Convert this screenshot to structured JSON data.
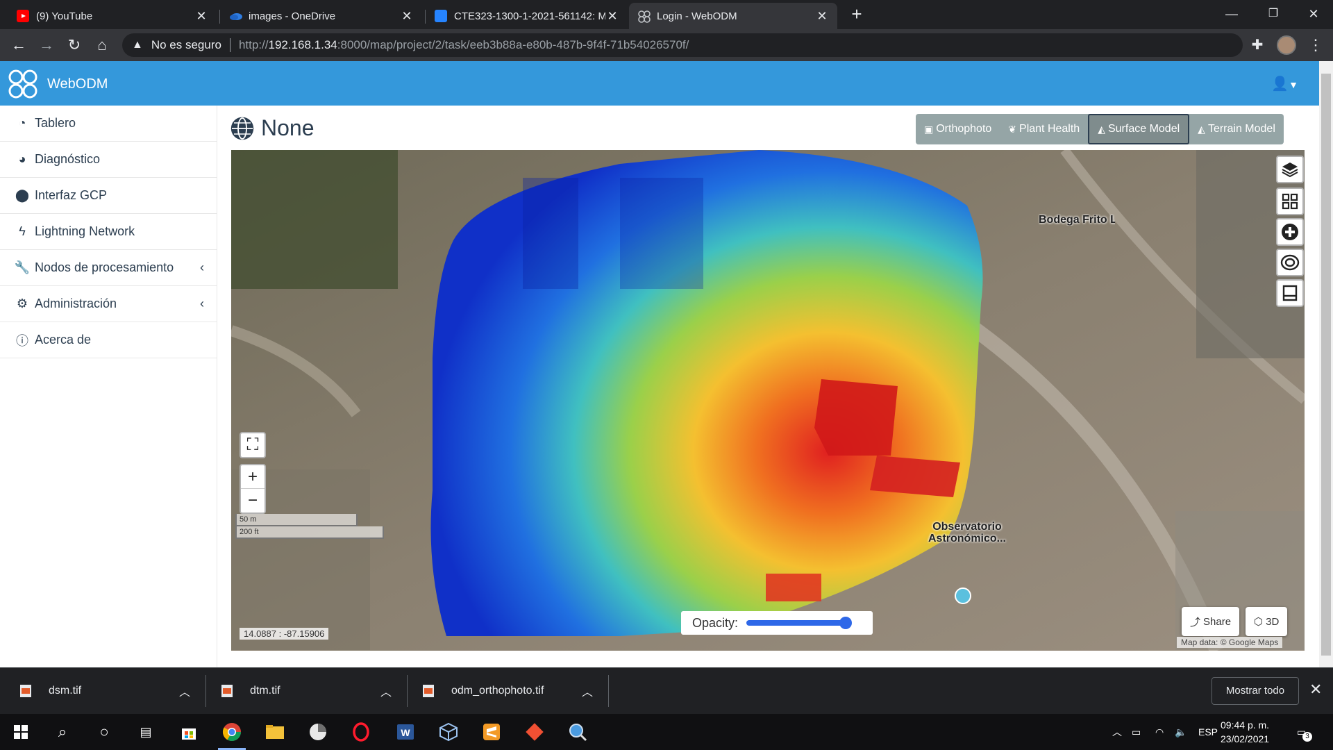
{
  "browser": {
    "tabs": [
      {
        "title": "(9) YouTube",
        "favicon": "youtube-icon",
        "color": "#ff0000"
      },
      {
        "title": "images - OneDrive",
        "favicon": "onedrive-icon",
        "color": "#2f7de1"
      },
      {
        "title": "CTE323-1300-1-2021-561142: M",
        "favicon": "jira-icon",
        "color": "#2684ff"
      },
      {
        "title": "Login - WebODM",
        "favicon": "webodm-icon",
        "color": "#9aa0a6"
      }
    ],
    "address": {
      "security_label": "No es seguro",
      "url_proto": "http://",
      "url_host": "192.168.1.34",
      "url_path": ":8000/map/project/2/task/eeb3b88a-e80b-487b-9f4f-71b54026570f/"
    }
  },
  "app": {
    "brand": "WebODM",
    "accent_color": "#3498db",
    "sidebar": {
      "items": [
        {
          "label": "Tablero",
          "icon": "dashboard-icon"
        },
        {
          "label": "Diagnóstico",
          "icon": "pie-chart-icon"
        },
        {
          "label": "Interfaz GCP",
          "icon": "map-marker-icon"
        },
        {
          "label": "Lightning Network",
          "icon": "bolt-icon"
        },
        {
          "label": "Nodos de procesamiento",
          "icon": "wrench-icon"
        },
        {
          "label": "Administración",
          "icon": "cogs-icon"
        },
        {
          "label": "Acerca de",
          "icon": "info-icon"
        }
      ]
    },
    "page_title": "None",
    "view_buttons": [
      {
        "label": "Orthophoto",
        "icon": "image-icon",
        "active": false
      },
      {
        "label": "Plant Health",
        "icon": "leaf-icon",
        "active": false
      },
      {
        "label": "Surface Model",
        "icon": "area-chart-icon",
        "active": true
      },
      {
        "label": "Terrain Model",
        "icon": "area-chart-icon",
        "active": false
      }
    ],
    "map": {
      "scale_m": "50 m",
      "scale_ft": "200 ft",
      "coords": "14.0887 : -87.15906",
      "opacity_label": "Opacity:",
      "opacity_value": 0.95,
      "share_label": "Share",
      "three_d_label": "3D",
      "attribution": "Map data: © Google Maps",
      "place_label_1": "Bodega Frito La",
      "place_label_2a": "Observatorio",
      "place_label_2b": "Astronómico..."
    }
  },
  "downloads": {
    "items": [
      {
        "name": "dsm.tif"
      },
      {
        "name": "dtm.tif"
      },
      {
        "name": "odm_orthophoto.tif"
      }
    ],
    "show_all": "Mostrar todo"
  },
  "taskbar": {
    "lang": "ESP",
    "time": "09:44 p. m.",
    "date": "23/02/2021",
    "notif_count": "3"
  }
}
